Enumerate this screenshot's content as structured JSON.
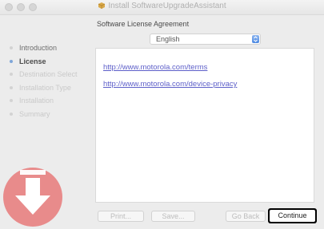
{
  "window": {
    "title": "Install SoftwareUpgradeAssistant"
  },
  "header": {
    "subtitle": "Software License Agreement"
  },
  "steps": [
    {
      "label": "Introduction",
      "state": "done"
    },
    {
      "label": "License",
      "state": "current"
    },
    {
      "label": "Destination Select",
      "state": "pending"
    },
    {
      "label": "Installation Type",
      "state": "pending"
    },
    {
      "label": "Installation",
      "state": "pending"
    },
    {
      "label": "Summary",
      "state": "pending"
    }
  ],
  "language_select": {
    "value": "English"
  },
  "content": {
    "links": [
      "http://www.motorola.com/terms",
      "http://www.motorola.com/device-privacy"
    ]
  },
  "buttons": {
    "print": "Print...",
    "save": "Save...",
    "go_back": "Go Back",
    "continue": "Continue"
  },
  "colors": {
    "link": "#5d5fc9",
    "accent": "#4e8ae2",
    "installer_icon": "#e88b8b"
  },
  "icons": {
    "title_icon": "package-icon",
    "installer": "download-arrow-icon"
  }
}
